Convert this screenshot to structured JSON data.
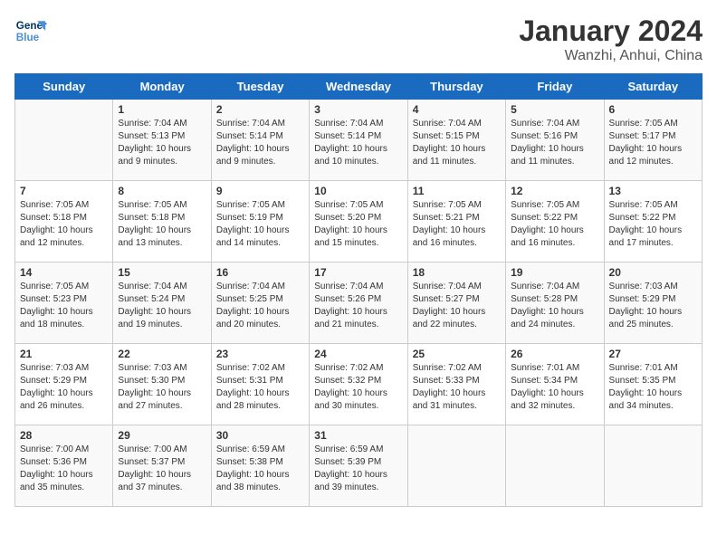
{
  "header": {
    "logo_line1": "General",
    "logo_line2": "Blue",
    "title": "January 2024",
    "subtitle": "Wanzhi, Anhui, China"
  },
  "weekdays": [
    "Sunday",
    "Monday",
    "Tuesday",
    "Wednesday",
    "Thursday",
    "Friday",
    "Saturday"
  ],
  "weeks": [
    [
      {
        "day": "",
        "info": ""
      },
      {
        "day": "1",
        "info": "Sunrise: 7:04 AM\nSunset: 5:13 PM\nDaylight: 10 hours\nand 9 minutes."
      },
      {
        "day": "2",
        "info": "Sunrise: 7:04 AM\nSunset: 5:14 PM\nDaylight: 10 hours\nand 9 minutes."
      },
      {
        "day": "3",
        "info": "Sunrise: 7:04 AM\nSunset: 5:14 PM\nDaylight: 10 hours\nand 10 minutes."
      },
      {
        "day": "4",
        "info": "Sunrise: 7:04 AM\nSunset: 5:15 PM\nDaylight: 10 hours\nand 11 minutes."
      },
      {
        "day": "5",
        "info": "Sunrise: 7:04 AM\nSunset: 5:16 PM\nDaylight: 10 hours\nand 11 minutes."
      },
      {
        "day": "6",
        "info": "Sunrise: 7:05 AM\nSunset: 5:17 PM\nDaylight: 10 hours\nand 12 minutes."
      }
    ],
    [
      {
        "day": "7",
        "info": "Sunrise: 7:05 AM\nSunset: 5:18 PM\nDaylight: 10 hours\nand 12 minutes."
      },
      {
        "day": "8",
        "info": "Sunrise: 7:05 AM\nSunset: 5:18 PM\nDaylight: 10 hours\nand 13 minutes."
      },
      {
        "day": "9",
        "info": "Sunrise: 7:05 AM\nSunset: 5:19 PM\nDaylight: 10 hours\nand 14 minutes."
      },
      {
        "day": "10",
        "info": "Sunrise: 7:05 AM\nSunset: 5:20 PM\nDaylight: 10 hours\nand 15 minutes."
      },
      {
        "day": "11",
        "info": "Sunrise: 7:05 AM\nSunset: 5:21 PM\nDaylight: 10 hours\nand 16 minutes."
      },
      {
        "day": "12",
        "info": "Sunrise: 7:05 AM\nSunset: 5:22 PM\nDaylight: 10 hours\nand 16 minutes."
      },
      {
        "day": "13",
        "info": "Sunrise: 7:05 AM\nSunset: 5:22 PM\nDaylight: 10 hours\nand 17 minutes."
      }
    ],
    [
      {
        "day": "14",
        "info": "Sunrise: 7:05 AM\nSunset: 5:23 PM\nDaylight: 10 hours\nand 18 minutes."
      },
      {
        "day": "15",
        "info": "Sunrise: 7:04 AM\nSunset: 5:24 PM\nDaylight: 10 hours\nand 19 minutes."
      },
      {
        "day": "16",
        "info": "Sunrise: 7:04 AM\nSunset: 5:25 PM\nDaylight: 10 hours\nand 20 minutes."
      },
      {
        "day": "17",
        "info": "Sunrise: 7:04 AM\nSunset: 5:26 PM\nDaylight: 10 hours\nand 21 minutes."
      },
      {
        "day": "18",
        "info": "Sunrise: 7:04 AM\nSunset: 5:27 PM\nDaylight: 10 hours\nand 22 minutes."
      },
      {
        "day": "19",
        "info": "Sunrise: 7:04 AM\nSunset: 5:28 PM\nDaylight: 10 hours\nand 24 minutes."
      },
      {
        "day": "20",
        "info": "Sunrise: 7:03 AM\nSunset: 5:29 PM\nDaylight: 10 hours\nand 25 minutes."
      }
    ],
    [
      {
        "day": "21",
        "info": "Sunrise: 7:03 AM\nSunset: 5:29 PM\nDaylight: 10 hours\nand 26 minutes."
      },
      {
        "day": "22",
        "info": "Sunrise: 7:03 AM\nSunset: 5:30 PM\nDaylight: 10 hours\nand 27 minutes."
      },
      {
        "day": "23",
        "info": "Sunrise: 7:02 AM\nSunset: 5:31 PM\nDaylight: 10 hours\nand 28 minutes."
      },
      {
        "day": "24",
        "info": "Sunrise: 7:02 AM\nSunset: 5:32 PM\nDaylight: 10 hours\nand 30 minutes."
      },
      {
        "day": "25",
        "info": "Sunrise: 7:02 AM\nSunset: 5:33 PM\nDaylight: 10 hours\nand 31 minutes."
      },
      {
        "day": "26",
        "info": "Sunrise: 7:01 AM\nSunset: 5:34 PM\nDaylight: 10 hours\nand 32 minutes."
      },
      {
        "day": "27",
        "info": "Sunrise: 7:01 AM\nSunset: 5:35 PM\nDaylight: 10 hours\nand 34 minutes."
      }
    ],
    [
      {
        "day": "28",
        "info": "Sunrise: 7:00 AM\nSunset: 5:36 PM\nDaylight: 10 hours\nand 35 minutes."
      },
      {
        "day": "29",
        "info": "Sunrise: 7:00 AM\nSunset: 5:37 PM\nDaylight: 10 hours\nand 37 minutes."
      },
      {
        "day": "30",
        "info": "Sunrise: 6:59 AM\nSunset: 5:38 PM\nDaylight: 10 hours\nand 38 minutes."
      },
      {
        "day": "31",
        "info": "Sunrise: 6:59 AM\nSunset: 5:39 PM\nDaylight: 10 hours\nand 39 minutes."
      },
      {
        "day": "",
        "info": ""
      },
      {
        "day": "",
        "info": ""
      },
      {
        "day": "",
        "info": ""
      }
    ]
  ]
}
